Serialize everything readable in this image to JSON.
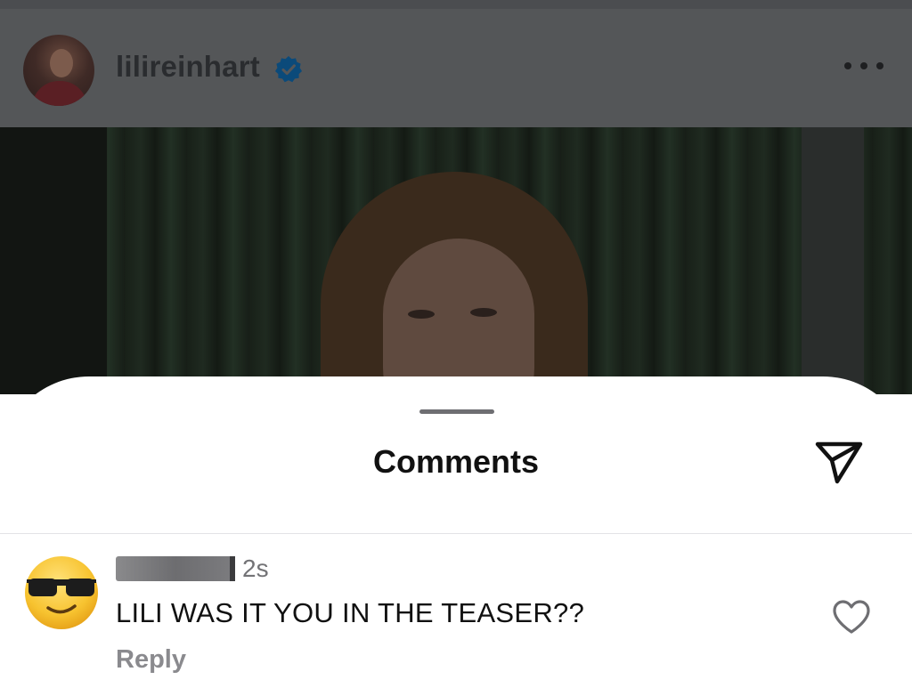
{
  "post": {
    "username": "lilireinhart",
    "verified": true,
    "avatar_icon": "profile-avatar",
    "more_icon": "more-horizontal-icon"
  },
  "sheet": {
    "title": "Comments",
    "share_icon": "paper-plane-icon"
  },
  "comments": [
    {
      "username_redacted": true,
      "time": "2s",
      "text": "LILI WAS IT YOU IN THE TEASER??",
      "reply_label": "Reply",
      "avatar_icon": "sunglasses-emoji-icon",
      "like_icon": "heart-outline-icon"
    }
  ],
  "colors": {
    "verified_blue": "#0095f6",
    "text_primary": "#111111",
    "text_secondary": "#737376",
    "dim_overlay": "#545658"
  }
}
